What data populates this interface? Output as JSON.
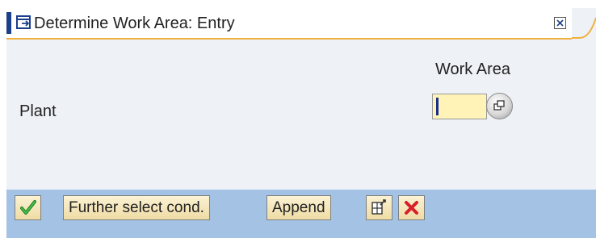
{
  "window": {
    "title": "Determine Work Area: Entry",
    "close_icon": "close-icon"
  },
  "content": {
    "column_header": "Work Area",
    "row_label": "Plant",
    "work_area_value": "",
    "value_help_icon": "value-help-icon"
  },
  "toolbar": {
    "continue_icon": "checkmark-icon",
    "further_select_label": "Further select cond.",
    "append_label": "Append",
    "multiple_select_icon": "multiple-selection-icon",
    "cancel_icon": "cancel-x-icon"
  },
  "colors": {
    "title_accent": "#1c3f8a",
    "title_underline": "#f0b040",
    "toolbar_bg": "#a3c2e4",
    "input_bg": "#fff3b8",
    "check_green": "#2e9a2e",
    "cancel_red": "#d8202a"
  }
}
